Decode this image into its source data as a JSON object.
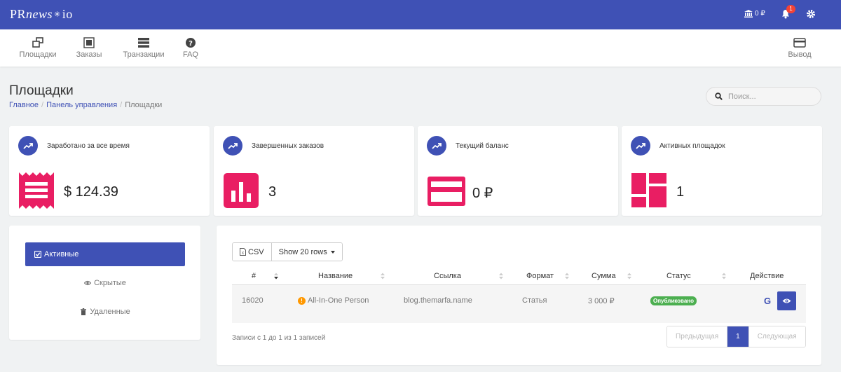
{
  "topbar": {
    "logo_pr": "PR",
    "logo_news": "news",
    "logo_star": "✳",
    "logo_io": "io",
    "balance": "0 ₽",
    "notifications_count": "1",
    "icons": [
      "bank-icon",
      "bell-icon",
      "gear-icon"
    ]
  },
  "nav": {
    "items": [
      {
        "label": "Площадки",
        "icon": "sites-icon"
      },
      {
        "label": "Заказы",
        "icon": "orders-icon"
      },
      {
        "label": "Транзакции",
        "icon": "transactions-icon"
      },
      {
        "label": "FAQ",
        "icon": "question-icon"
      }
    ],
    "withdraw": {
      "label": "Вывод",
      "icon": "card-icon"
    }
  },
  "page": {
    "title": "Площадки",
    "breadcrumb": [
      "Главное",
      "Панель управления",
      "Площадки"
    ]
  },
  "search": {
    "placeholder": "Поиск..."
  },
  "stats": [
    {
      "title": "Заработано за все время",
      "value": "$ 124.39",
      "icon": "receipt-icon"
    },
    {
      "title": "Завершенных заказов",
      "value": "3",
      "icon": "bar-chart-icon"
    },
    {
      "title": "Текущий баланс",
      "value": "0 ₽",
      "icon": "credit-card-icon"
    },
    {
      "title": "Активных площадок",
      "value": "1",
      "icon": "dashboard-icon"
    }
  ],
  "colors": {
    "accent": "#3f51b5",
    "pink": "#e91e63",
    "success": "#4caf50",
    "warning": "#ff9800"
  },
  "filters": [
    {
      "label": "Активные",
      "active": true,
      "icon": "check-square-icon"
    },
    {
      "label": "Скрытые",
      "active": false,
      "icon": "eye-icon"
    },
    {
      "label": "Удаленные",
      "active": false,
      "icon": "trash-icon"
    }
  ],
  "table": {
    "csv_label": "CSV",
    "rows_label": "Show 20 rows",
    "columns": [
      "#",
      "Название",
      "Ссылка",
      "Формат",
      "Сумма",
      "Статус",
      "Действие"
    ],
    "rows": [
      {
        "id": "16020",
        "name": "All-In-One Person",
        "link": "blog.themarfa.name",
        "format": "Статья",
        "amount": "3 000 ₽",
        "status": "Опубликовано"
      }
    ],
    "info": "Записи с 1 до 1 из 1 записей",
    "pagination": {
      "prev": "Предыдущая",
      "current": "1",
      "next": "Следующая"
    }
  }
}
